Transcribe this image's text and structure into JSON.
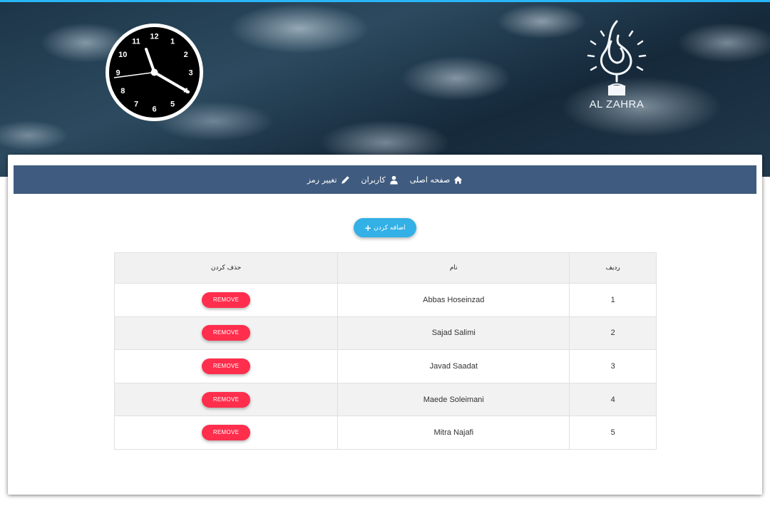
{
  "brand": {
    "logo_text": "AL ZAHRA"
  },
  "clock": {
    "numerals": [
      "12",
      "1",
      "2",
      "3",
      "4",
      "5",
      "6",
      "7",
      "8",
      "9",
      "10",
      "11"
    ]
  },
  "nav": {
    "items": [
      {
        "label": "صفحه اصلی",
        "icon": "home-icon"
      },
      {
        "label": "کاربران",
        "icon": "user-icon"
      },
      {
        "label": "تغییر رمز",
        "icon": "pencil-icon"
      }
    ]
  },
  "actions": {
    "add_label": "اضافه کردن"
  },
  "table": {
    "headers": {
      "index": "ردیف",
      "name": "نام",
      "delete": "حذف کردن"
    },
    "remove_label": "REMOVE",
    "rows": [
      {
        "index": "1",
        "name": "Abbas Hoseinzad"
      },
      {
        "index": "2",
        "name": "Sajad Salimi"
      },
      {
        "index": "3",
        "name": "Javad Saadat"
      },
      {
        "index": "4",
        "name": "Maede Soleimani"
      },
      {
        "index": "5",
        "name": "Mitra Najafi"
      }
    ]
  },
  "colors": {
    "nav_bg": "#3f5b7f",
    "accent": "#33b0e6",
    "danger": "#ff2e4c",
    "top_line": "#29b6f6"
  }
}
